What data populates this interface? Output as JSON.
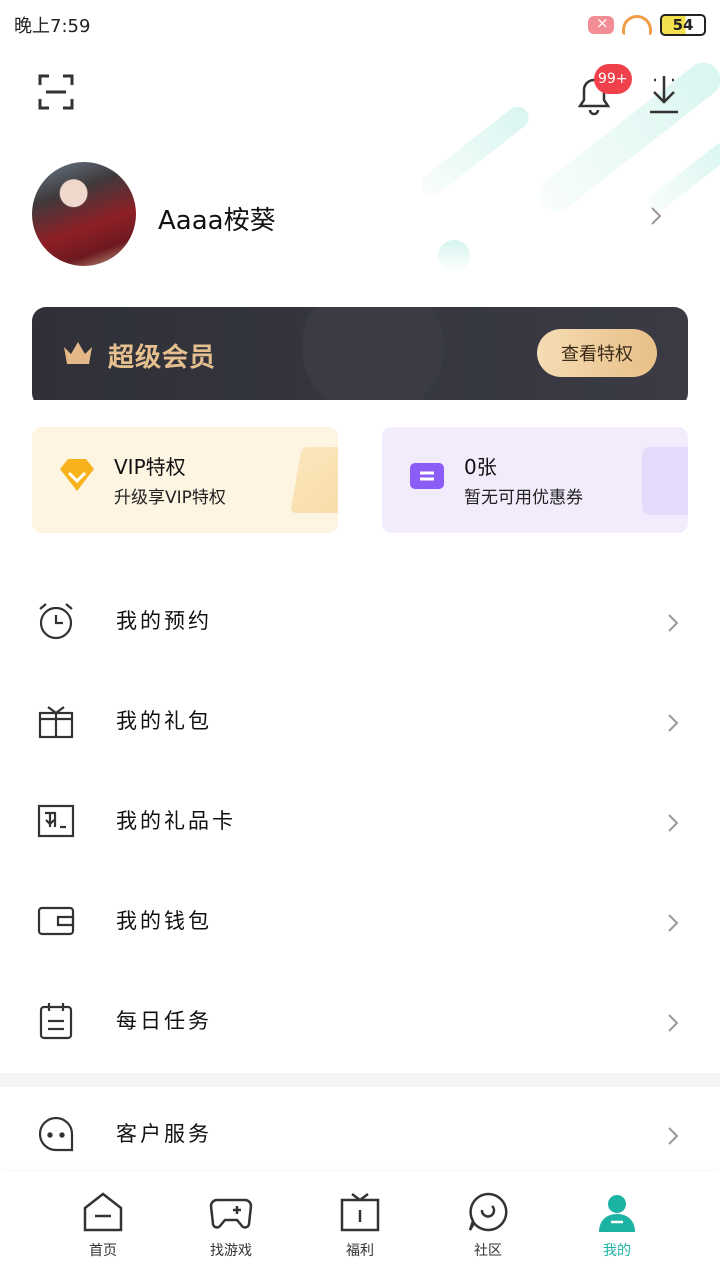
{
  "status_bar": {
    "time": "晚上7:59",
    "battery": "54"
  },
  "header": {
    "notification_badge": "99+"
  },
  "profile": {
    "username": "Aaaa桉葵"
  },
  "vip_banner": {
    "title": "超级会员",
    "button": "查看特权"
  },
  "cards": {
    "vip": {
      "title": "VIP特权",
      "subtitle": "升级享VIP特权"
    },
    "coupon": {
      "title": "0张",
      "subtitle": "暂无可用优惠券"
    }
  },
  "menu": {
    "items": [
      {
        "label": "我的预约",
        "icon": "alarm-clock-icon"
      },
      {
        "label": "我的礼包",
        "icon": "gift-box-icon"
      },
      {
        "label": "我的礼品卡",
        "icon": "gift-card-icon"
      },
      {
        "label": "我的钱包",
        "icon": "wallet-icon"
      },
      {
        "label": "每日任务",
        "icon": "task-list-icon"
      },
      {
        "label": "客户服务",
        "icon": "customer-service-icon"
      }
    ]
  },
  "tab_bar": {
    "items": [
      {
        "label": "首页",
        "icon": "home-icon"
      },
      {
        "label": "找游戏",
        "icon": "gamepad-icon"
      },
      {
        "label": "福利",
        "icon": "welfare-gift-icon"
      },
      {
        "label": "社区",
        "icon": "community-icon"
      },
      {
        "label": "我的",
        "icon": "profile-icon"
      }
    ],
    "active_index": 4
  },
  "colors": {
    "accent": "#1bb3a3",
    "badge": "#f0414a",
    "vip_gold": "#e7c08f"
  }
}
